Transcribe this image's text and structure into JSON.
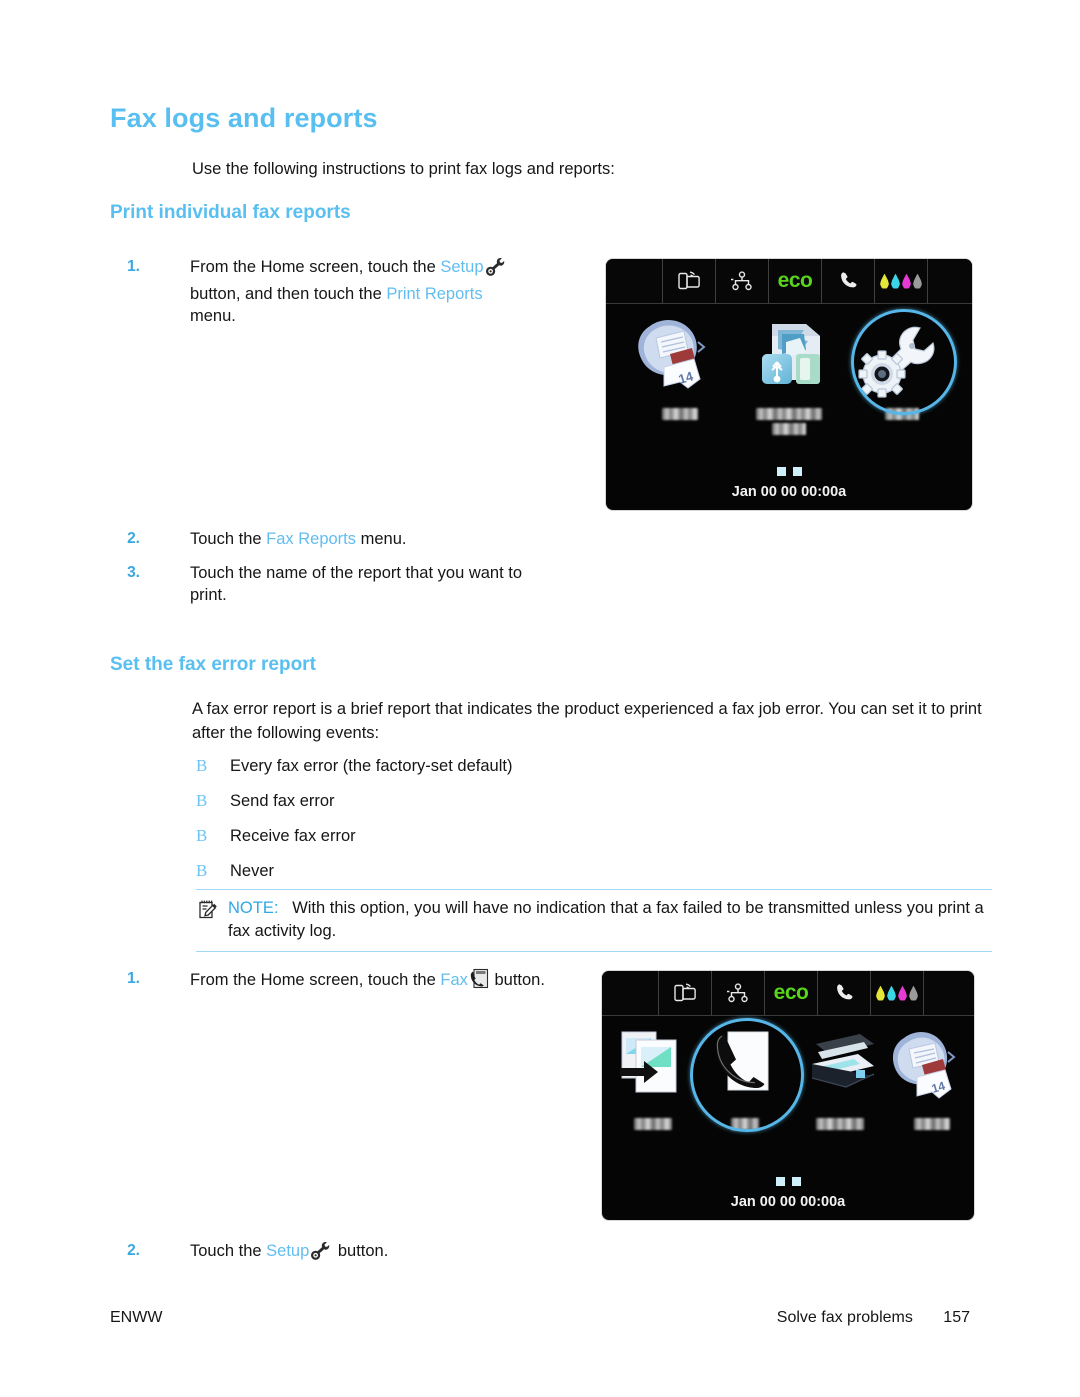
{
  "document": {
    "title": "Fax logs and reports",
    "intro": "Use the following instructions to print fax logs and reports:"
  },
  "sections": {
    "print_reports": {
      "heading": "Print individual fax reports",
      "steps": [
        {
          "number": "1.",
          "text_1": "From the Home screen, touch the ",
          "link_1": "Setup",
          "icon_1": "setup-gear-wrench-icon",
          "text_2": " button, and then touch the ",
          "link_2": "Print Reports",
          "text_3": " menu."
        },
        {
          "number": "2.",
          "text_1": "Touch the ",
          "link_1": "Fax Reports",
          "text_2": " menu."
        },
        {
          "number": "3.",
          "text_1": "Touch the name of the report that you want to print."
        }
      ]
    },
    "error_report": {
      "heading": "Set the fax error report",
      "intro": "A fax error report is a brief report that indicates the product experienced a fax job error. You can set it to print after the following events:",
      "bullet_marker": "B",
      "bullets": [
        "Every fax error (the factory-set default)",
        "Send fax error",
        "Receive fax error",
        "Never"
      ],
      "note": {
        "icon": "note-pad-pencil-icon",
        "label": "NOTE:",
        "text": "With this option, you will have no indication that a fax failed to be transmitted unless you print a fax activity log."
      },
      "steps": [
        {
          "number": "1.",
          "text_1": "From the Home screen, touch the ",
          "link_1": "Fax",
          "icon_1": "fax-handset-page-icon",
          "text_2": " button."
        },
        {
          "number": "2.",
          "text_1": "Touch the ",
          "link_1": "Setup",
          "icon_1": "setup-gear-wrench-icon",
          "text_2": " button."
        }
      ]
    }
  },
  "control_panel_1": {
    "status_bar": {
      "icons": [
        "wireless-direct-icon",
        "network-icon",
        "eco-label",
        "phone-handset-icon",
        "ink-levels-icon"
      ],
      "eco_label": "eco",
      "ink_colors": [
        "#e4e63a",
        "#3ad5e6",
        "#e63ad5",
        "#9a9a9a"
      ]
    },
    "tiles": [
      {
        "name": "web-apps-icon",
        "highlighted": false
      },
      {
        "name": "usb-memory-icon",
        "highlighted": false
      },
      {
        "name": "setup-gear-wrench-icon",
        "highlighted": true
      }
    ],
    "page_dots": 2,
    "datetime": "Jan 00 00 00:00a",
    "highlight_color": "#57b6e8"
  },
  "control_panel_2": {
    "status_bar": {
      "icons": [
        "wireless-direct-icon",
        "network-icon",
        "eco-label",
        "phone-handset-icon",
        "ink-levels-icon"
      ],
      "eco_label": "eco",
      "ink_colors": [
        "#e4e63a",
        "#3ad5e6",
        "#e63ad5",
        "#9a9a9a"
      ]
    },
    "tiles": [
      {
        "name": "copy-icon",
        "highlighted": false
      },
      {
        "name": "fax-handset-page-icon",
        "highlighted": true
      },
      {
        "name": "scan-flatbed-icon",
        "highlighted": false
      },
      {
        "name": "web-apps-icon",
        "highlighted": false
      }
    ],
    "page_dots": 2,
    "datetime": "Jan 00 00 00:00a",
    "highlight_color": "#57b6e8"
  },
  "footer": {
    "left": "ENWW",
    "section": "Solve fax problems",
    "page_number": "157"
  },
  "colors": {
    "heading_blue": "#59bff0",
    "link_blue": "#62bdf0",
    "eco_green": "#58d41c",
    "note_rule": "#9ed8f5"
  }
}
